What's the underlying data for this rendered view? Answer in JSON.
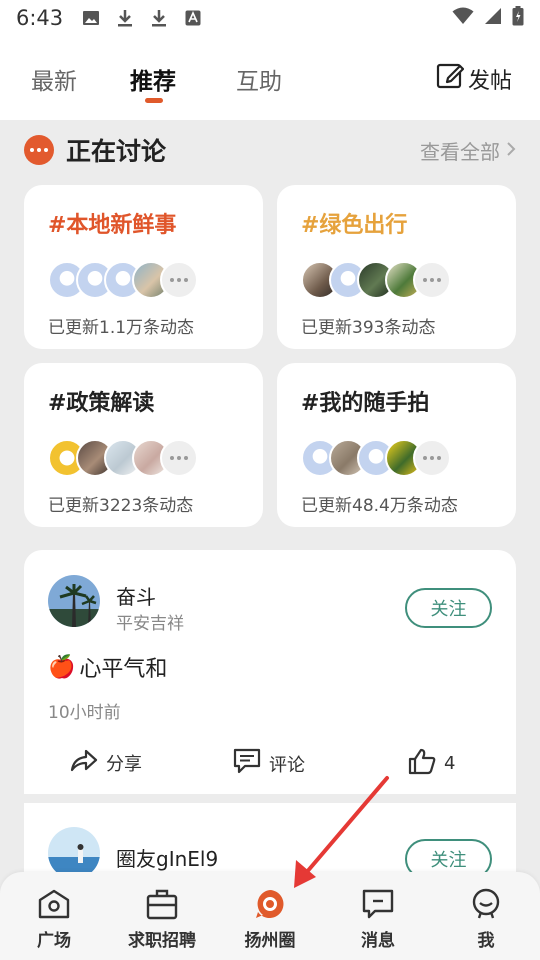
{
  "status_bar": {
    "time": "6:43"
  },
  "top_tabs": [
    {
      "label": "最新"
    },
    {
      "label": "推荐"
    },
    {
      "label": "互助"
    }
  ],
  "post_button": {
    "label": "发帖",
    "icon": "edit-icon"
  },
  "discussion": {
    "title": "正在讨论",
    "view_all": "查看全部",
    "topics": [
      {
        "name": "#本地新鲜事",
        "count": "已更新1.1万条动态",
        "color": "#e0552a"
      },
      {
        "name": "#绿色出行",
        "count": "已更新393条动态",
        "color": "#e6a23c"
      },
      {
        "name": "#政策解读",
        "count": "已更新3223条动态",
        "color": "#222222"
      },
      {
        "name": "#我的随手拍",
        "count": "已更新48.4万条动态",
        "color": "#222222"
      }
    ]
  },
  "posts": [
    {
      "author": "奋斗",
      "subtitle": "平安吉祥",
      "follow": "关注",
      "content_emoji": "🍎",
      "content": "心平气和",
      "time": "10小时前",
      "share": "分享",
      "comment": "评论",
      "likes": "4"
    },
    {
      "author": "圈友gInEl9",
      "follow": "关注"
    }
  ],
  "bottom_nav": [
    {
      "label": "广场",
      "icon": "square-icon"
    },
    {
      "label": "求职招聘",
      "icon": "briefcase-icon"
    },
    {
      "label": "扬州圈",
      "icon": "circle-icon"
    },
    {
      "label": "消息",
      "icon": "message-icon"
    },
    {
      "label": "我",
      "icon": "profile-icon"
    }
  ],
  "colors": {
    "accent": "#e05a2b",
    "follow": "#3f8f7c",
    "annotation_arrow": "#e53935"
  }
}
